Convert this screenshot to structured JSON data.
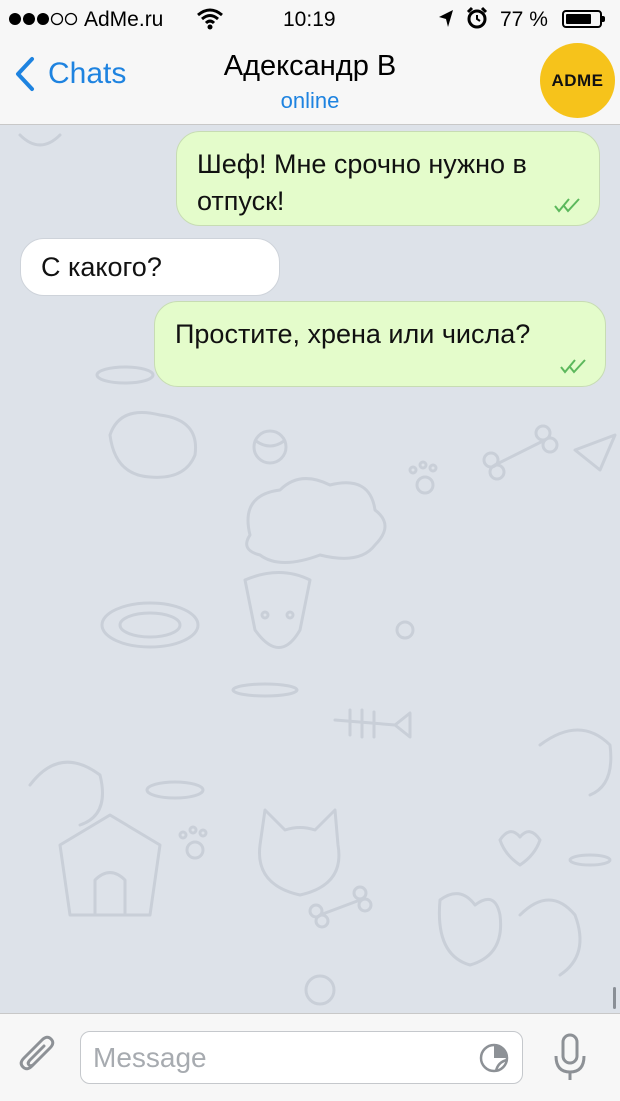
{
  "status_bar": {
    "carrier": "AdMe.ru",
    "time": "10:19",
    "battery_percent": "77 %",
    "battery_level": 0.77,
    "signal_icon": "signal-dots-icon",
    "wifi_icon": "wifi-icon",
    "location_icon": "location-arrow-icon",
    "alarm_icon": "alarm-clock-icon"
  },
  "nav": {
    "back_label": "Chats",
    "contact_name": "Адександр В",
    "status": "online",
    "avatar_text": "ADME",
    "accent_color": "#1e83e0",
    "avatar_color": "#f6c31b"
  },
  "messages": [
    {
      "direction": "outgoing",
      "lines": [
        "Шеф! Мне срочно нужно в",
        "отпуск!"
      ],
      "read": true
    },
    {
      "direction": "incoming",
      "lines": [
        "С какого?"
      ]
    },
    {
      "direction": "outgoing",
      "lines": [
        "Простите, хрена или числа?"
      ],
      "read": true
    }
  ],
  "input": {
    "placeholder": "Message",
    "attach_icon": "paperclip-icon",
    "sticker_icon": "sticker-icon",
    "mic_icon": "microphone-icon"
  },
  "colors": {
    "outgoing_bubble": "#e4fccb",
    "incoming_bubble": "#ffffff",
    "chat_background": "#dde2e9",
    "read_ticks": "#5cb85c"
  }
}
